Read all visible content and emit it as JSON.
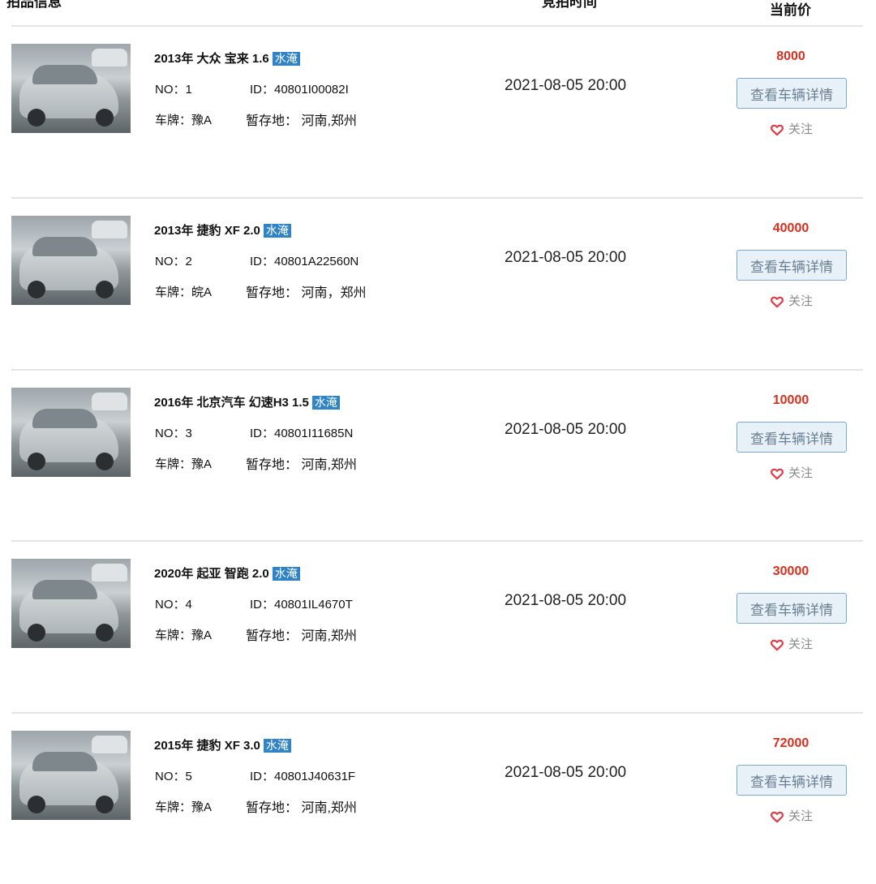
{
  "header": {
    "info_label": "拍品信息",
    "time_label": "竞拍时间",
    "price_label": "当前价"
  },
  "colors": {
    "price": "#d8301e",
    "tag_bg": "#2f83c9",
    "button_border": "#79a9d4",
    "button_bg": "#e8f0f8",
    "heart": "#e23b45"
  },
  "listings": [
    {
      "title": "2013年 大众 宝来 1.6",
      "tag": "水淹",
      "no": "NO：1",
      "id": "ID：40801I00082I",
      "plate": "车牌：豫A",
      "location": "暂存地： 河南,郑州",
      "time": "2021-08-05 20:00",
      "price": "8000",
      "detail_label": "查看车辆详情",
      "follow_label": "关注",
      "follow_icon": "heart-icon",
      "image": "car-photo"
    },
    {
      "title": "2013年 捷豹 XF 2.0",
      "tag": "水淹",
      "no": "NO：2",
      "id": "ID：40801A22560N",
      "plate": "车牌：皖A",
      "location": "暂存地： 河南，郑州",
      "time": "2021-08-05 20:00",
      "price": "40000",
      "detail_label": "查看车辆详情",
      "follow_label": "关注",
      "follow_icon": "heart-icon",
      "image": "car-photo"
    },
    {
      "title": "2016年 北京汽车 幻速H3 1.5",
      "tag": "水淹",
      "no": "NO：3",
      "id": "ID：40801I11685N",
      "plate": "车牌：豫A",
      "location": "暂存地： 河南,郑州",
      "time": "2021-08-05 20:00",
      "price": "10000",
      "detail_label": "查看车辆详情",
      "follow_label": "关注",
      "follow_icon": "heart-icon",
      "image": "car-photo"
    },
    {
      "title": "2020年 起亚 智跑 2.0",
      "tag": "水淹",
      "no": "NO：4",
      "id": "ID：40801IL4670T",
      "plate": "车牌：豫A",
      "location": "暂存地： 河南,郑州",
      "time": "2021-08-05 20:00",
      "price": "30000",
      "detail_label": "查看车辆详情",
      "follow_label": "关注",
      "follow_icon": "heart-icon",
      "image": "car-photo"
    },
    {
      "title": "2015年 捷豹 XF 3.0",
      "tag": "水淹",
      "no": "NO：5",
      "id": "ID：40801J40631F",
      "plate": "车牌：豫A",
      "location": "暂存地： 河南,郑州",
      "time": "2021-08-05 20:00",
      "price": "72000",
      "detail_label": "查看车辆详情",
      "follow_label": "关注",
      "follow_icon": "heart-icon",
      "image": "car-photo"
    }
  ]
}
